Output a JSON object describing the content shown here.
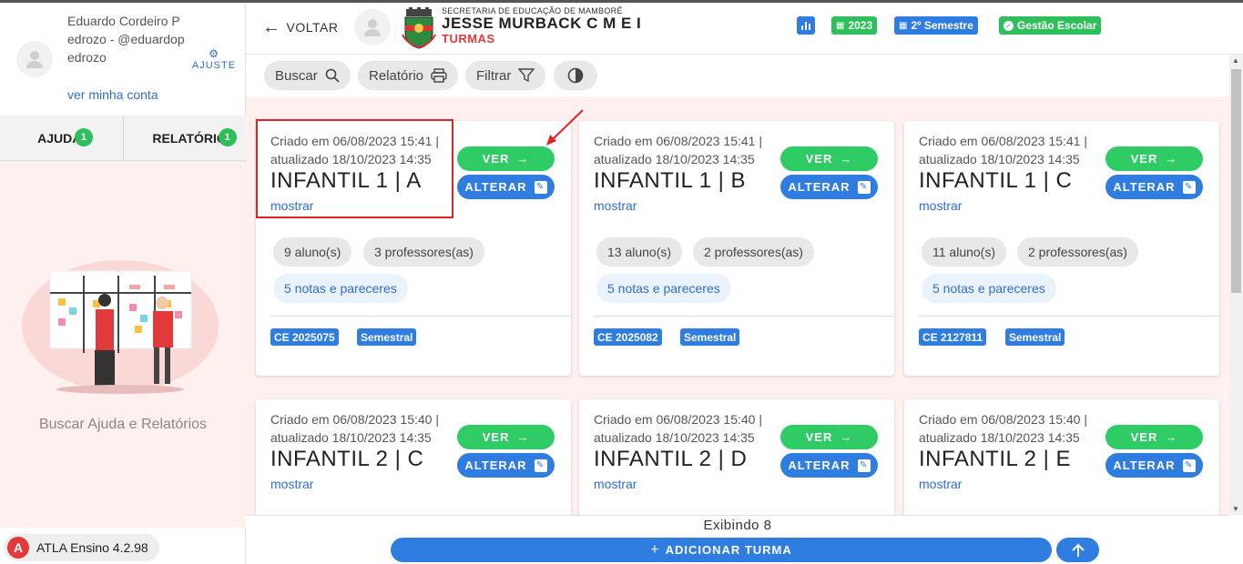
{
  "colors": {
    "accent_blue": "#2f7de1",
    "green": "#2fcc66",
    "red": "#e23a3a",
    "bg_pink": "#fdf0ef"
  },
  "user": {
    "name": "Eduardo Cordeiro Pedrozo - @eduardopedrozo",
    "account_link": "ver minha conta",
    "settings_label": "AJUSTE"
  },
  "sidebar": {
    "tabs": [
      {
        "label": "AJUDA",
        "count": "1"
      },
      {
        "label": "RELATÓRIOS",
        "count": "1"
      }
    ],
    "help_text": "Buscar Ajuda e Relatórios",
    "version": "ATLA Ensino 4.2.98"
  },
  "header": {
    "back_label": "VOLTAR",
    "secretaria": "SECRETARIA DE EDUCAÇÃO DE MAMBORÊ",
    "school_name": "JESSE MURBACK C M E I",
    "section": "TURMAS",
    "chips": [
      {
        "label": "",
        "icon": "chart-icon"
      },
      {
        "label": "2023",
        "icon": "calendar-icon"
      },
      {
        "label": "2º Semestre",
        "icon": "calendar-icon"
      },
      {
        "label": "Gestão Escolar",
        "icon": "check-icon"
      }
    ]
  },
  "toolbar": {
    "search_label": "Buscar",
    "report_label": "Relatório",
    "filter_label": "Filtrar"
  },
  "cards": [
    {
      "created": "Criado em 06/08/2023 15:41 |",
      "updated": "atualizado 18/10/2023 14:35",
      "title": "INFANTIL 1 | A",
      "show": "mostrar",
      "view": "VER",
      "edit": "ALTERAR",
      "students": "9 aluno(s)",
      "teachers": "3 professores(as)",
      "notes": "5 notas e pareceres",
      "code": "CE 2025075",
      "period": "Semestral"
    },
    {
      "created": "Criado em 06/08/2023 15:41 |",
      "updated": "atualizado 18/10/2023 14:35",
      "title": "INFANTIL 1 | B",
      "show": "mostrar",
      "view": "VER",
      "edit": "ALTERAR",
      "students": "13 aluno(s)",
      "teachers": "2 professores(as)",
      "notes": "5 notas e pareceres",
      "code": "CE 2025082",
      "period": "Semestral"
    },
    {
      "created": "Criado em 06/08/2023 15:41 |",
      "updated": "atualizado 18/10/2023 14:35",
      "title": "INFANTIL 1 | C",
      "show": "mostrar",
      "view": "VER",
      "edit": "ALTERAR",
      "students": "11 aluno(s)",
      "teachers": "2 professores(as)",
      "notes": "5 notas e pareceres",
      "code": "CE 2127811",
      "period": "Semestral"
    },
    {
      "created": "Criado em 06/08/2023 15:40 |",
      "updated": "atualizado 18/10/2023 14:35",
      "title": "INFANTIL 2 | C",
      "show": "mostrar",
      "view": "VER",
      "edit": "ALTERAR"
    },
    {
      "created": "Criado em 06/08/2023 15:40 |",
      "updated": "atualizado 18/10/2023 14:35",
      "title": "INFANTIL 2 | D",
      "show": "mostrar",
      "view": "VER",
      "edit": "ALTERAR"
    },
    {
      "created": "Criado em 06/08/2023 15:40 |",
      "updated": "atualizado 18/10/2023 14:35",
      "title": "INFANTIL 2 | E",
      "show": "mostrar",
      "view": "VER",
      "edit": "ALTERAR"
    }
  ],
  "footer": {
    "count_label": "Exibindo 8",
    "add_label": "ADICIONAR TURMA"
  }
}
